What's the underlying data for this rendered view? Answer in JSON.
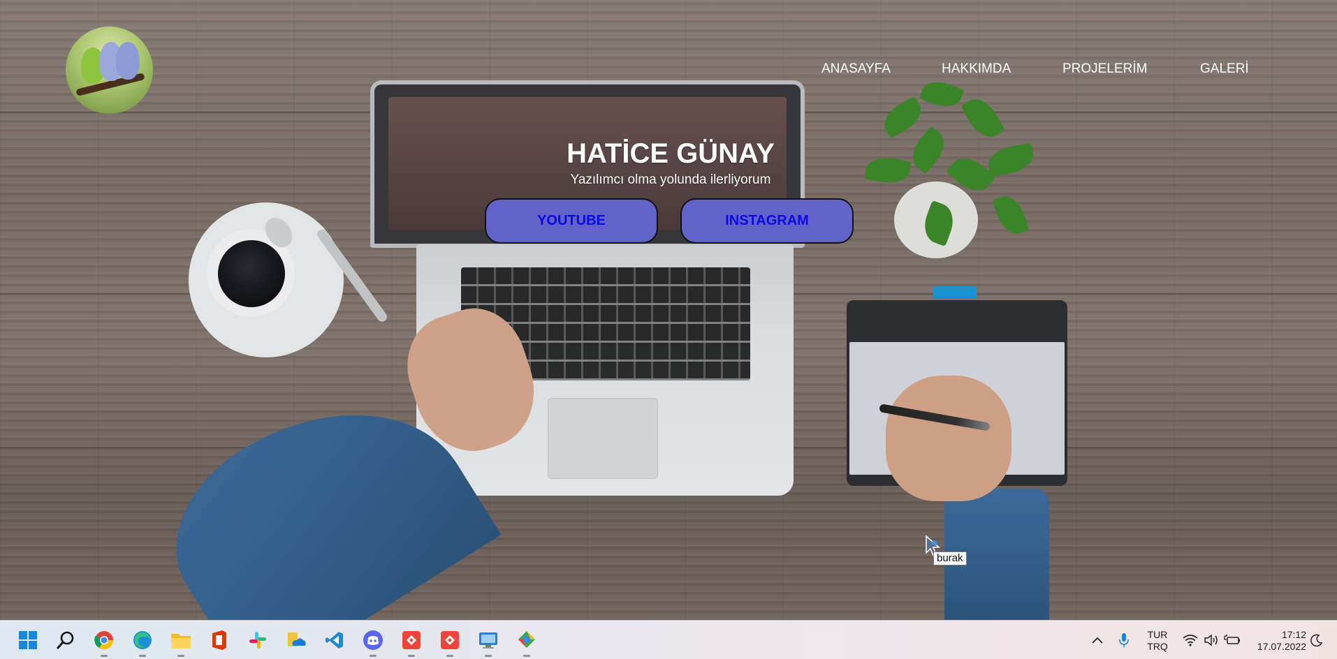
{
  "site": {
    "logo_icon": "budgie-birds-logo",
    "nav": [
      {
        "label": "ANASAYFA"
      },
      {
        "label": "HAKKIMDA"
      },
      {
        "label": "PROJELERİM"
      },
      {
        "label": "GALERİ"
      }
    ],
    "hero": {
      "title": "HATİCE GÜNAY",
      "subtitle": "Yazılımcı olma yolunda ilerliyorum",
      "buttons": [
        {
          "label": "YOUTUBE"
        },
        {
          "label": "INSTAGRAM"
        }
      ]
    },
    "colors": {
      "button_bg": "#6262c8",
      "button_text": "#0a0ae6",
      "nav_text": "#ffffff"
    }
  },
  "cursor": {
    "tooltip": "burak"
  },
  "taskbar": {
    "apps": [
      {
        "name": "start-icon"
      },
      {
        "name": "search-icon"
      },
      {
        "name": "chrome-icon"
      },
      {
        "name": "edge-icon"
      },
      {
        "name": "file-explorer-icon"
      },
      {
        "name": "office-icon"
      },
      {
        "name": "slack-icon"
      },
      {
        "name": "onedrive-icon"
      },
      {
        "name": "vscode-icon"
      },
      {
        "name": "discord-icon"
      },
      {
        "name": "anydesk-icon"
      },
      {
        "name": "anydesk-icon-2"
      },
      {
        "name": "control-panel-icon"
      },
      {
        "name": "app-icon"
      }
    ],
    "tray": {
      "language_top": "TUR",
      "language_bottom": "TRQ",
      "time": "17:12",
      "date": "17.07.2022"
    }
  }
}
